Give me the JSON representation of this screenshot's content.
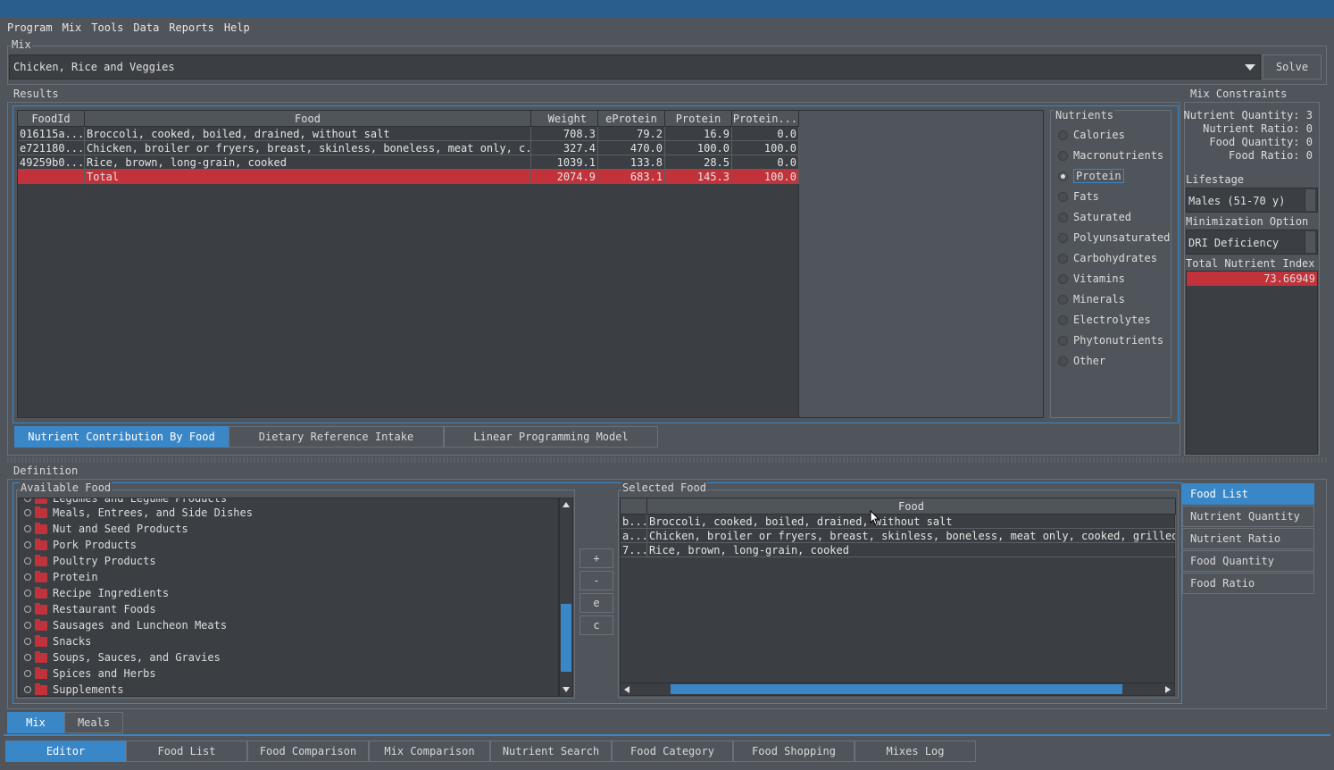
{
  "menu": [
    "Program",
    "Mix",
    "Tools",
    "Data",
    "Reports",
    "Help"
  ],
  "mix": {
    "legend": "Mix",
    "selected": "Chicken, Rice and Veggies",
    "solve_label": "Solve"
  },
  "results": {
    "legend": "Results",
    "columns": [
      "FoodId",
      "Food",
      "Weight",
      "eProtein",
      "Protein",
      "Protein..."
    ],
    "rows": [
      {
        "id": "016115a...",
        "food": "Broccoli, cooked, boiled, drained, without salt",
        "weight": "708.3",
        "eprotein": "79.2",
        "protein": "16.9",
        "protein_pct": "0.0"
      },
      {
        "id": "e721180...",
        "food": "Chicken, broiler or fryers, breast, skinless, boneless, meat only, c...",
        "weight": "327.4",
        "eprotein": "470.0",
        "protein": "100.0",
        "protein_pct": "100.0"
      },
      {
        "id": "49259b0...",
        "food": "Rice, brown, long-grain, cooked",
        "weight": "1039.1",
        "eprotein": "133.8",
        "protein": "28.5",
        "protein_pct": "0.0"
      }
    ],
    "total": {
      "id": "",
      "food": "Total",
      "weight": "2074.9",
      "eprotein": "683.1",
      "protein": "145.3",
      "protein_pct": "100.0"
    },
    "tabs": [
      "Nutrient Contribution By Food",
      "Dietary Reference Intake",
      "Linear Programming Model"
    ]
  },
  "nutrients": {
    "legend": "Nutrients",
    "items": [
      "Calories",
      "Macronutrients",
      "Protein",
      "Fats",
      "Saturated",
      "Polyunsaturated",
      "Carbohydrates",
      "Vitamins",
      "Minerals",
      "Electrolytes",
      "Phytonutrients",
      "Other"
    ],
    "selected": "Protein"
  },
  "constraints": {
    "legend": "Mix Constraints",
    "items": [
      {
        "label": "Nutrient Quantity:",
        "value": "3"
      },
      {
        "label": "Nutrient Ratio:",
        "value": "0"
      },
      {
        "label": "Food Quantity:",
        "value": "0"
      },
      {
        "label": "Food Ratio:",
        "value": "0"
      }
    ],
    "lifestage_label": "Lifestage",
    "lifestage_value": "Males (51-70 y)",
    "minimization_label": "Minimization Option",
    "minimization_value": "DRI Deficiency",
    "tni_label": "Total Nutrient Index",
    "tni_value": "73.66949"
  },
  "definition": {
    "legend": "Definition",
    "available_legend": "Available Food",
    "categories": [
      "Legumes and Legume Products",
      "Meals, Entrees, and Side Dishes",
      "Nut and Seed Products",
      "Pork Products",
      "Poultry Products",
      "Protein",
      "Recipe Ingredients",
      "Restaurant Foods",
      "Sausages and Luncheon Meats",
      "Snacks",
      "Soups, Sauces, and Gravies",
      "Spices and Herbs",
      "Supplements"
    ],
    "buttons": [
      "+",
      "-",
      "e",
      "c"
    ],
    "selected_legend": "Selected Food",
    "selected_header": "Food",
    "selected_rows": [
      {
        "id": "b...",
        "food": "Broccoli, cooked, boiled, drained, without salt"
      },
      {
        "id": "a...",
        "food": "Chicken, broiler or fryers, breast, skinless, boneless, meat only, cooked, grilled"
      },
      {
        "id": "7...",
        "food": "Rice, brown, long-grain, cooked"
      }
    ],
    "side_tabs": [
      "Food List",
      "Nutrient Quantity",
      "Nutrient Ratio",
      "Food Quantity",
      "Food Ratio"
    ]
  },
  "inner_tabs": [
    "Mix",
    "Meals"
  ],
  "bottom_tabs": [
    "Editor",
    "Food List",
    "Food Comparison",
    "Mix Comparison",
    "Nutrient Search",
    "Food Category",
    "Food Shopping",
    "Mixes Log"
  ],
  "colors": {
    "accent": "#3a87c8",
    "total_row": "#c1323a",
    "background": "#50555b"
  }
}
